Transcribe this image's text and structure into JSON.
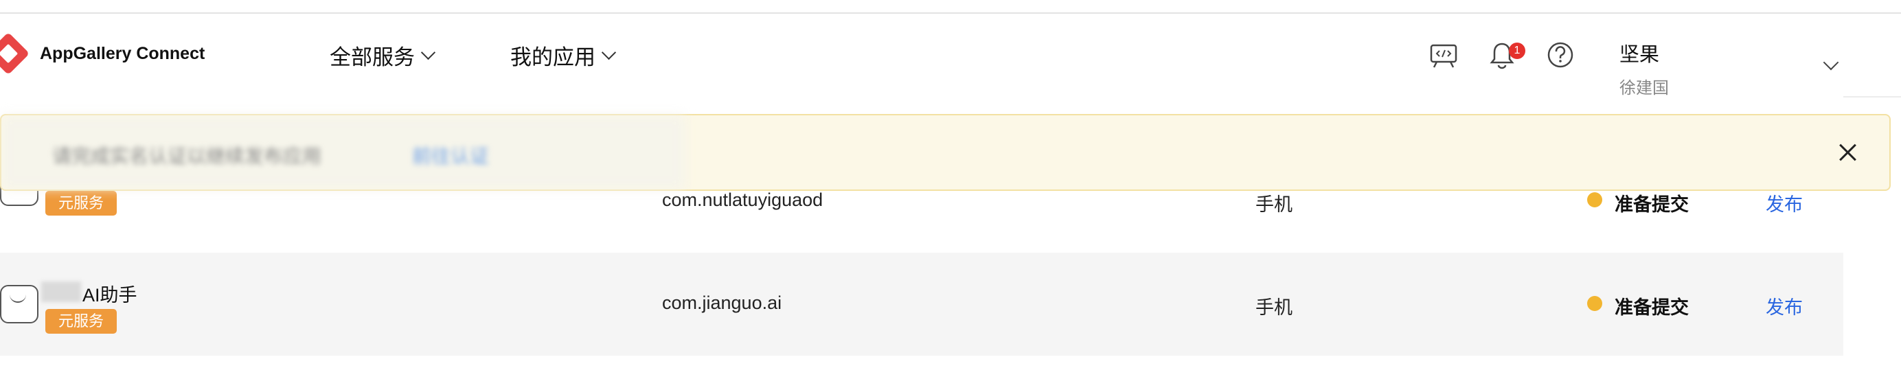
{
  "header": {
    "brand": "AppGallery Connect",
    "nav": [
      {
        "label": "全部服务"
      },
      {
        "label": "我的应用"
      }
    ],
    "notification_count": "1",
    "user": {
      "name": "坚果",
      "subtitle": "徐建国"
    }
  },
  "banner": {
    "text": "请完成实名认证以继续发布应用",
    "link": "前往认证"
  },
  "apps": [
    {
      "name": "",
      "tag": "元服务",
      "package": "com.nutlatuyiguaod",
      "device": "手机",
      "status": "准备提交",
      "action": "发布"
    },
    {
      "name": "AI助手",
      "tag": "元服务",
      "package": "com.jianguo.ai",
      "device": "手机",
      "status": "准备提交",
      "action": "发布"
    }
  ],
  "colors": {
    "accent": "#2a66e0",
    "tag": "#ef9a3b",
    "status": "#f2b530",
    "brand": "#e84545",
    "banner_bg": "#fcf8e7"
  }
}
